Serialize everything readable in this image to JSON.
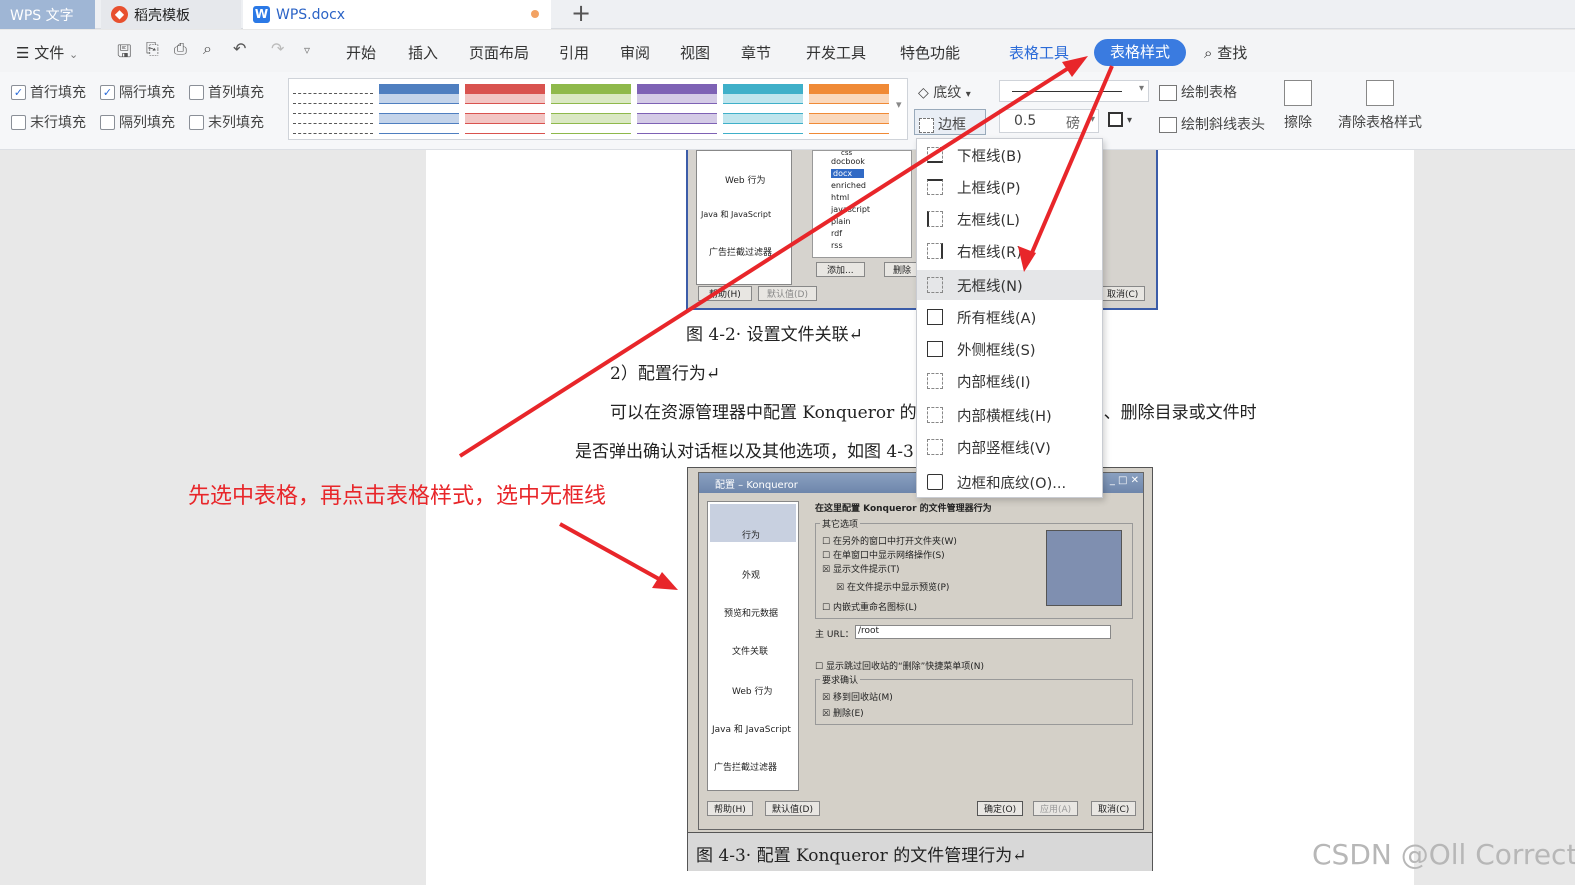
{
  "tabs": {
    "app": "WPS 文字",
    "template": "稻壳模板",
    "doc": "WPS.docx",
    "add": "+"
  },
  "menu": {
    "file": "文件",
    "items": [
      "开始",
      "插入",
      "页面布局",
      "引用",
      "审阅",
      "视图",
      "章节",
      "开发工具",
      "特色功能"
    ],
    "table_tools": "表格工具",
    "table_style": "表格样式",
    "find": "查找"
  },
  "ribbon": {
    "checks": [
      {
        "label": "首行填充",
        "checked": true
      },
      {
        "label": "隔行填充",
        "checked": true
      },
      {
        "label": "首列填充",
        "checked": false
      },
      {
        "label": "末行填充",
        "checked": false
      },
      {
        "label": "隔列填充",
        "checked": false
      },
      {
        "label": "末列填充",
        "checked": false
      }
    ],
    "shading": "底纹",
    "border": "边框",
    "width": "0.5",
    "unit": "磅",
    "draw_table": "绘制表格",
    "draw_diag": "绘制斜线表头",
    "erase": "擦除",
    "clear_style": "清除表格样式",
    "swatch_colors": [
      "#9a9a9a",
      "#4f7fc0",
      "#d9534f",
      "#8fb94b",
      "#7e62b5",
      "#3fb0c9",
      "#f08a36"
    ]
  },
  "dropdown": [
    "下框线(B)",
    "上框线(P)",
    "左框线(L)",
    "右框线(R)",
    "无框线(N)",
    "所有框线(A)",
    "外侧框线(S)",
    "内部框线(I)",
    "内部横框线(H)",
    "内部竖框线(V)",
    "边框和底纹(O)..."
  ],
  "doc": {
    "fig1_labels": [
      "Web 行为",
      "Java 和 JavaScript",
      "广告拦截过滤器"
    ],
    "fig1_files": [
      "css",
      "docbook",
      "docx",
      "enriched",
      "html",
      "javascript",
      "plain",
      "rdf",
      "rss"
    ],
    "fig1_buttons": [
      "添加...",
      "删除",
      "帮助(H)",
      "默认值(D)",
      "取消(C)"
    ],
    "caption1": "图 4-2· 设置文件关联↵",
    "heading": "2）配置行为↵",
    "para1": "可以在资源管理器中配置 Konqueror 的文件管理行为，如在创建、删除目录或文件时",
    "para2": "是否弹出确认对话框以及其他选项，如图 4-3",
    "caption2": "图 4-3· 配置 Konqueror 的文件管理行为↵",
    "dialog": {
      "title": "配置 – Konqueror",
      "header": "在这里配置 Konqueror 的文件管理器行为",
      "side": [
        "行为",
        "外观",
        "预览和元数据",
        "文件关联",
        "Web 行为",
        "Java 和 JavaScript",
        "广告拦截过滤器"
      ],
      "group1": "其它选项",
      "opts": [
        {
          "t": "在另外的窗口中打开文件夹(W)",
          "c": false
        },
        {
          "t": "在单窗口中显示网络操作(S)",
          "c": false
        },
        {
          "t": "显示文件提示(T)",
          "c": true
        },
        {
          "t": "在文件提示中显示预览(P)",
          "c": true
        },
        {
          "t": "内嵌式重命名图标(L)",
          "c": false
        }
      ],
      "url_label": "主 URL：",
      "url": "/root",
      "opt_trash": "显示跳过回收站的“删除”快捷菜单项(N)",
      "group2": "要求确认",
      "confirm": [
        {
          "t": "移到回收站(M)",
          "c": true
        },
        {
          "t": "删除(E)",
          "c": true
        }
      ],
      "buttons": [
        "帮助(H)",
        "默认值(D)",
        "确定(O)",
        "应用(A)",
        "取消(C)"
      ]
    }
  },
  "annotation": "先选中表格，再点击表格样式，选中无框线",
  "watermark": "CSDN @Oll Correct",
  "colors": {
    "accent": "#3a7be0",
    "arrow": "#e8262a"
  }
}
